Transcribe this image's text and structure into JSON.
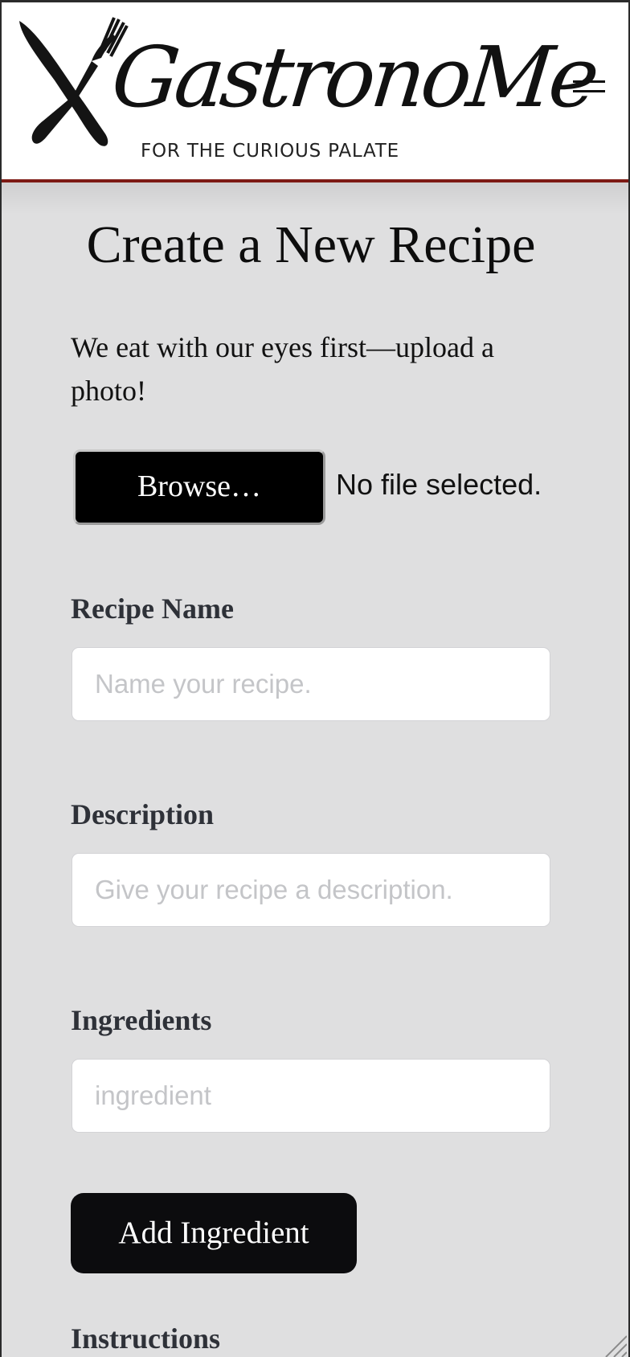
{
  "header": {
    "brand_name": "GastronoMe",
    "tagline": "FOR THE CURIOUS PALATE",
    "logo_icon": "fork-and-knife-icon",
    "menu_icon": "hamburger-menu-icon",
    "accent_color": "#7d1a14"
  },
  "main": {
    "title": "Create a New Recipe",
    "upload_note": "We eat with our eyes first—upload a photo!",
    "browse_label": "Browse…",
    "file_status": "No file selected.",
    "recipe_name": {
      "label": "Recipe Name",
      "placeholder": "Name your recipe.",
      "value": ""
    },
    "description": {
      "label": "Description",
      "placeholder": "Give your recipe a description.",
      "value": ""
    },
    "ingredients": {
      "label": "Ingredients",
      "placeholder": "ingredient",
      "value": ""
    },
    "add_ingredient_label": "Add Ingredient",
    "instructions_label": "Instructions"
  }
}
